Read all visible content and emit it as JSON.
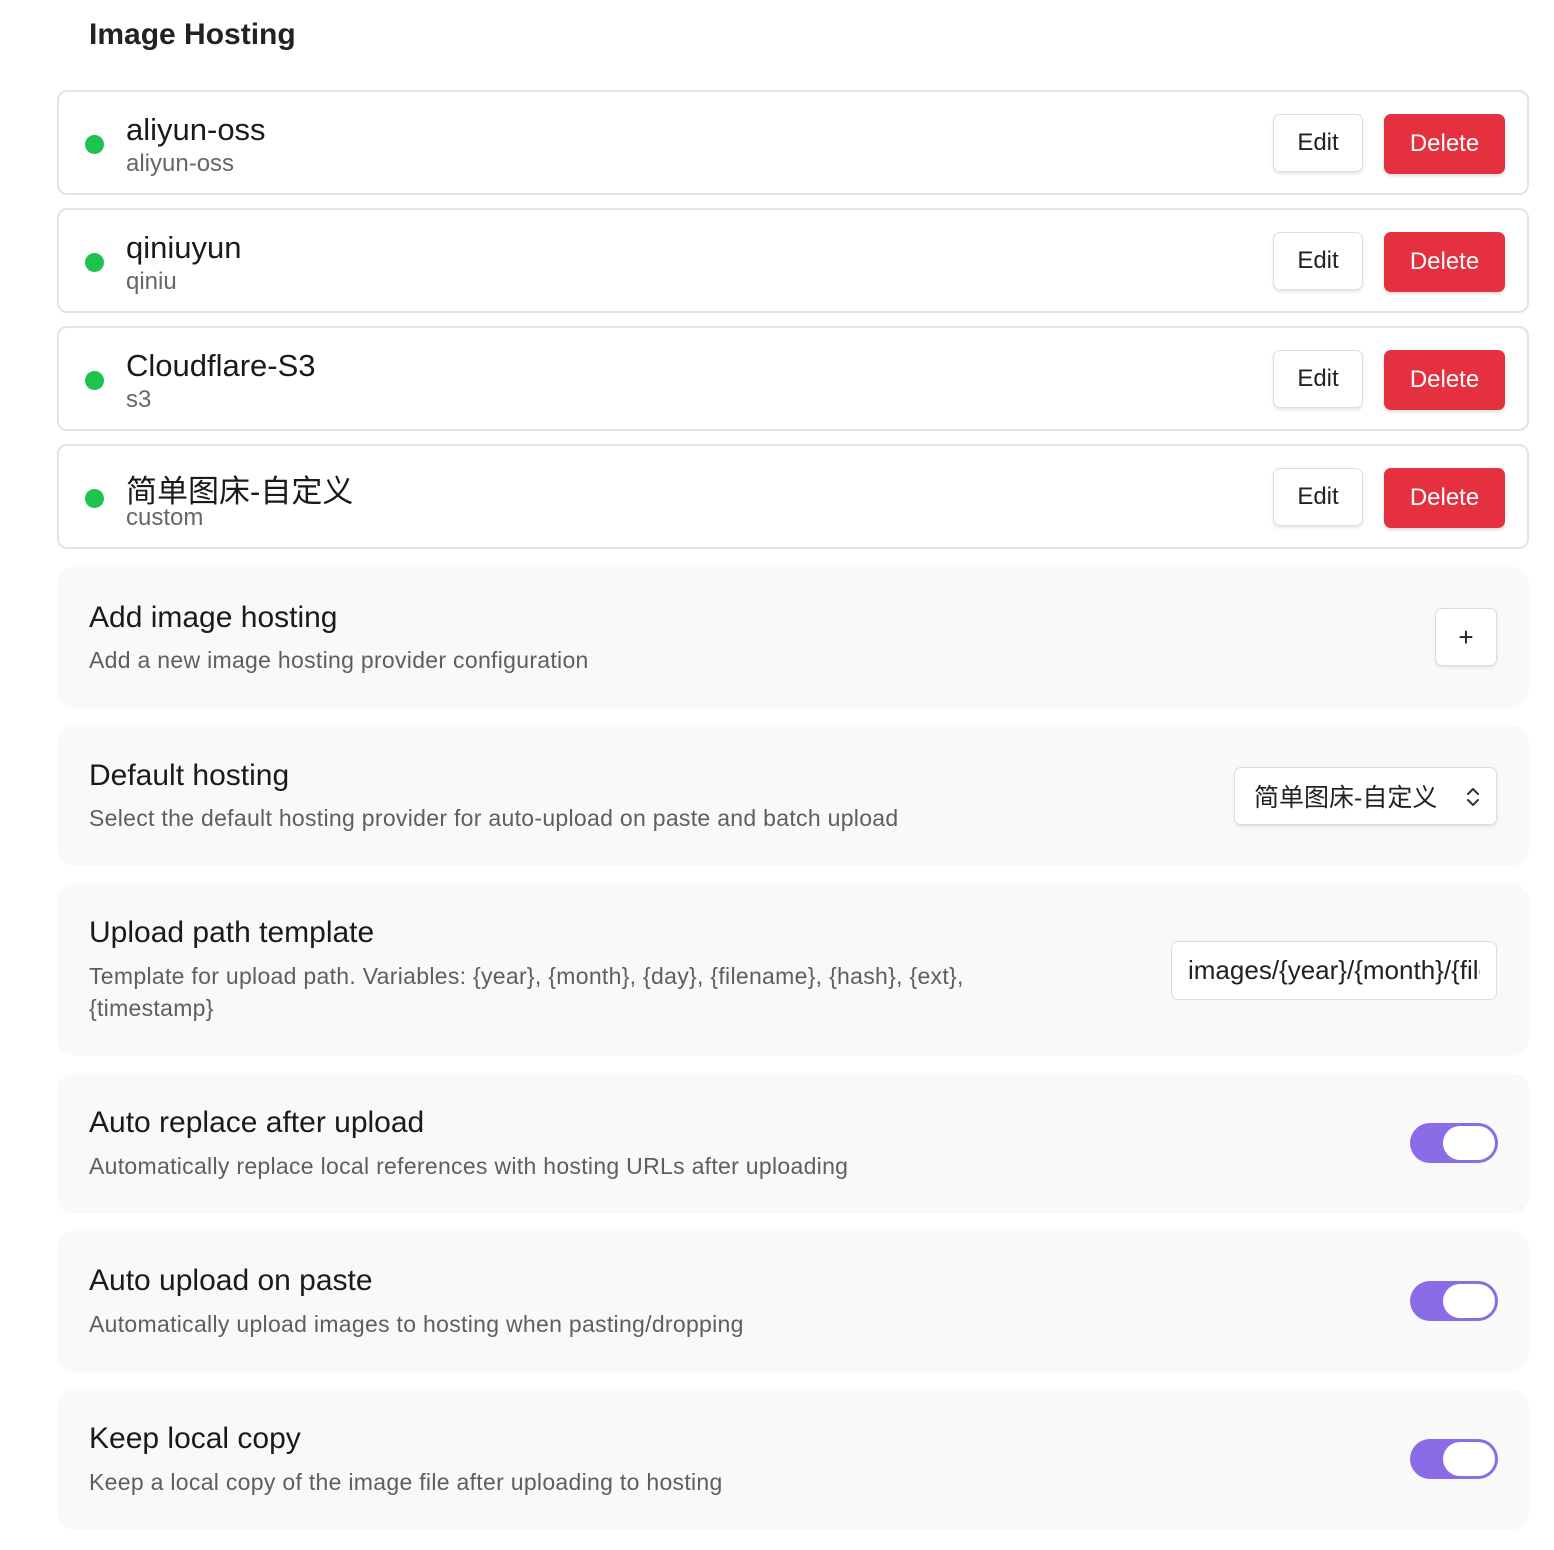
{
  "section_title": "Image Hosting",
  "hostings": [
    {
      "name": "aliyun-oss",
      "type": "aliyun-oss",
      "status": "active"
    },
    {
      "name": "qiniuyun",
      "type": "qiniu",
      "status": "active"
    },
    {
      "name": "Cloudflare-S3",
      "type": "s3",
      "status": "active"
    },
    {
      "name": "简单图床-自定义",
      "type": "custom",
      "status": "active"
    }
  ],
  "actions": {
    "edit_label": "Edit",
    "delete_label": "Delete"
  },
  "add_hosting": {
    "title": "Add image hosting",
    "description": "Add a new image hosting provider configuration",
    "button_label": "+"
  },
  "default_hosting": {
    "title": "Default hosting",
    "description": "Select the default hosting provider for auto-upload on paste and batch upload",
    "selected": "简单图床-自定义"
  },
  "upload_path": {
    "title": "Upload path template",
    "description": "Template for upload path. Variables: {year}, {month}, {day}, {filename}, {hash}, {ext}, {timestamp}",
    "value": "images/{year}/{month}/{filename}"
  },
  "auto_replace": {
    "title": "Auto replace after upload",
    "description": "Automatically replace local references with hosting URLs after uploading",
    "enabled": true
  },
  "auto_upload": {
    "title": "Auto upload on paste",
    "description": "Automatically upload images to hosting when pasting/dropping",
    "enabled": true
  },
  "keep_local": {
    "title": "Keep local copy",
    "description": "Keep a local copy of the image file after uploading to hosting",
    "enabled": true
  },
  "colors": {
    "status_active": "#1ec24f",
    "delete": "#e5303f",
    "toggle_on": "#8a6ce6",
    "setting_bg": "#f9f9f9"
  },
  "icons": {
    "status": "status-dot-icon",
    "select": "chevron-up-down-icon",
    "add": "plus-icon"
  }
}
